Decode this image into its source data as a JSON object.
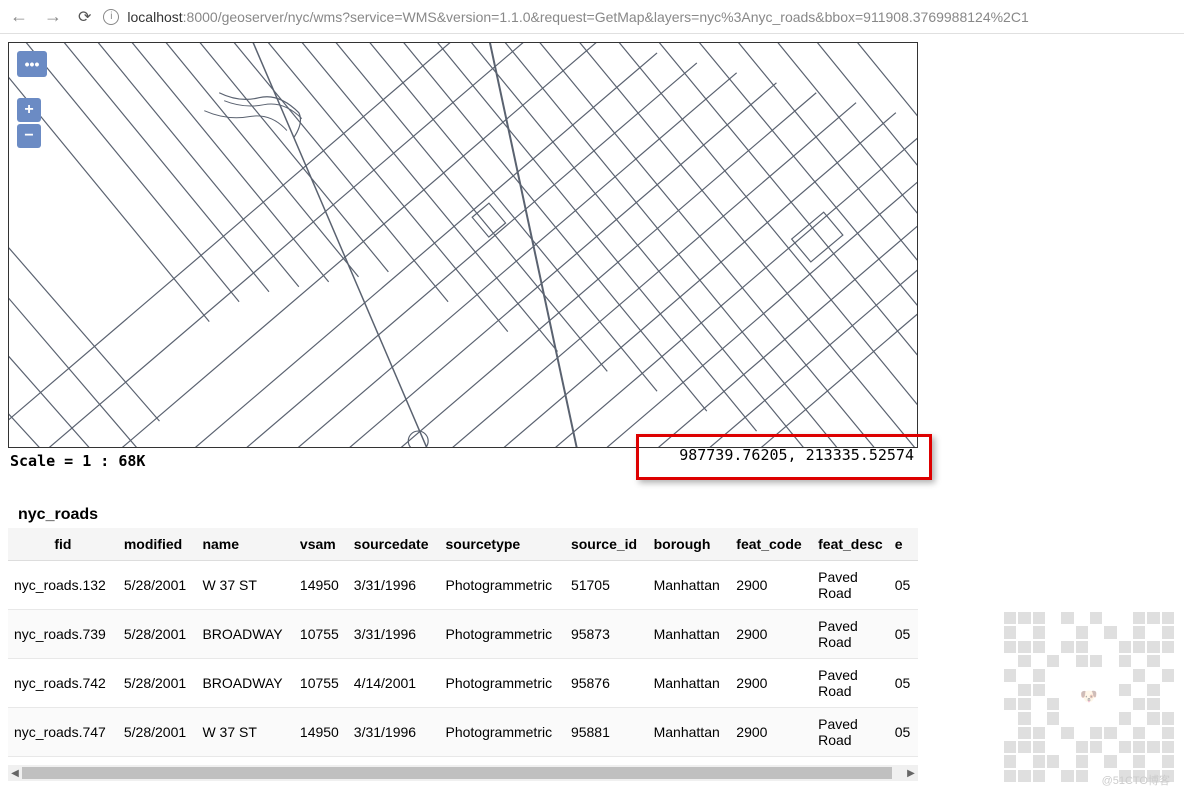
{
  "browser": {
    "url_host": "localhost",
    "url_path": ":8000/geoserver/nyc/wms?service=WMS&version=1.1.0&request=GetMap&layers=nyc%3Anyc_roads&bbox=911908.3769988124%2C1"
  },
  "map": {
    "scale_label": "Scale = 1 : 68K",
    "coordinates": "987739.76205, 213335.52574"
  },
  "table": {
    "title": "nyc_roads",
    "columns": [
      "fid",
      "modified",
      "name",
      "vsam",
      "sourcedate",
      "sourcetype",
      "source_id",
      "borough",
      "feat_code",
      "feat_desc",
      "e"
    ],
    "rows": [
      {
        "fid": "nyc_roads.132",
        "modified": "5/28/2001",
        "name": "W 37 ST",
        "vsam": "14950",
        "sourcedate": "3/31/1996",
        "sourcetype": "Photogrammetric",
        "source_id": "51705",
        "borough": "Manhattan",
        "feat_code": "2900",
        "feat_desc": "Paved Road",
        "e": "05"
      },
      {
        "fid": "nyc_roads.739",
        "modified": "5/28/2001",
        "name": "BROADWAY",
        "vsam": "10755",
        "sourcedate": "3/31/1996",
        "sourcetype": "Photogrammetric",
        "source_id": "95873",
        "borough": "Manhattan",
        "feat_code": "2900",
        "feat_desc": "Paved Road",
        "e": "05"
      },
      {
        "fid": "nyc_roads.742",
        "modified": "5/28/2001",
        "name": "BROADWAY",
        "vsam": "10755",
        "sourcedate": "4/14/2001",
        "sourcetype": "Photogrammetric",
        "source_id": "95876",
        "borough": "Manhattan",
        "feat_code": "2900",
        "feat_desc": "Paved Road",
        "e": "05"
      },
      {
        "fid": "nyc_roads.747",
        "modified": "5/28/2001",
        "name": "W 37 ST",
        "vsam": "14950",
        "sourcedate": "3/31/1996",
        "sourcetype": "Photogrammetric",
        "source_id": "95881",
        "borough": "Manhattan",
        "feat_code": "2900",
        "feat_desc": "Paved Road",
        "e": "05"
      }
    ]
  },
  "watermark": "@51CTO博客"
}
